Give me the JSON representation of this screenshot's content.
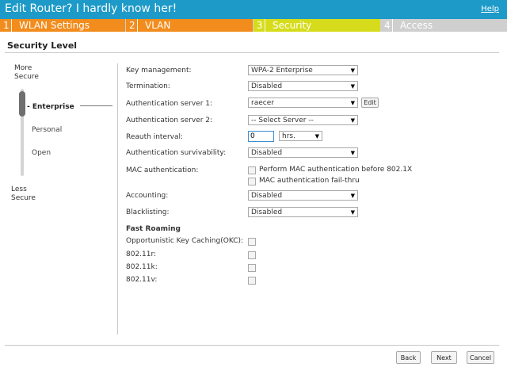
{
  "header": {
    "title": "Edit Router? I hardly know her!",
    "help": "Help"
  },
  "tabs": [
    {
      "num": "1",
      "label": "WLAN Settings"
    },
    {
      "num": "2",
      "label": "VLAN"
    },
    {
      "num": "3",
      "label": "Security",
      "active": true
    },
    {
      "num": "4",
      "label": "Access"
    }
  ],
  "section_title": "Security Level",
  "levels": {
    "more": [
      "More",
      "Secure"
    ],
    "less": [
      "Less",
      "Secure"
    ],
    "options": [
      "- Enterprise",
      "Personal",
      "Open"
    ],
    "selected": "Enterprise"
  },
  "form": {
    "key_management": {
      "label": "Key management:",
      "value": "WPA-2 Enterprise"
    },
    "termination": {
      "label": "Termination:",
      "value": "Disabled"
    },
    "auth_server_1": {
      "label": "Authentication server 1:",
      "value": "raecer",
      "edit": "Edit"
    },
    "auth_server_2": {
      "label": "Authentication server 2:",
      "value": "-- Select Server --"
    },
    "reauth": {
      "label": "Reauth interval:",
      "value": "0",
      "unit": "hrs."
    },
    "survivability": {
      "label": "Authentication survivability:",
      "value": "Disabled"
    },
    "mac_auth": {
      "label": "MAC authentication:",
      "opt1": "Perform MAC authentication before 802.1X",
      "opt2": "MAC authentication fail-thru"
    },
    "accounting": {
      "label": "Accounting:",
      "value": "Disabled"
    },
    "blacklisting": {
      "label": "Blacklisting:",
      "value": "Disabled"
    }
  },
  "fast_roaming": {
    "title": "Fast Roaming",
    "okc": "Opportunistic Key Caching(OKC):",
    "r": "802.11r:",
    "k": "802.11k:",
    "v": "802.11v:"
  },
  "footer": {
    "back": "Back",
    "next": "Next",
    "cancel": "Cancel"
  },
  "colors": {
    "header": "#1d9ac8",
    "tab_orange": "#f28c1c",
    "tab_active": "#d6dc1c",
    "tab_inactive": "#cfcfcf"
  }
}
